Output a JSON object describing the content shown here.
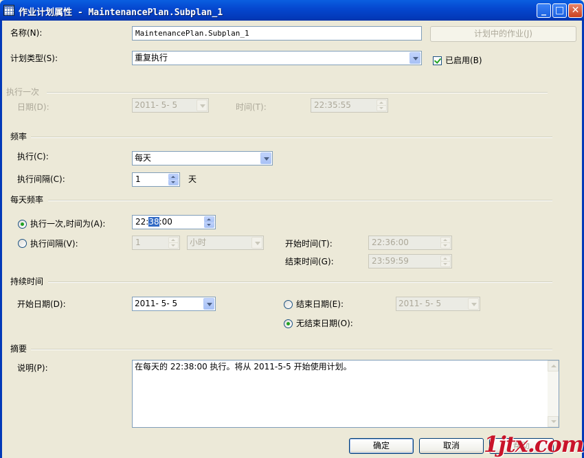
{
  "window": {
    "title": "作业计划属性 - MaintenancePlan.Subplan_1",
    "icon": "grid-icon",
    "buttons": {
      "minimize": "_",
      "maximize": "□",
      "close": "✕"
    }
  },
  "general": {
    "name_label": "名称(N):",
    "name_value": "MaintenancePlan.Subplan_1",
    "jobs_button": "计划中的作业(J)",
    "type_label": "计划类型(S):",
    "type_value": "重复执行",
    "enabled_label": "已启用(B)",
    "enabled_checked": true
  },
  "once": {
    "section_title": "执行一次",
    "date_label": "日期(D):",
    "date_value": "2011- 5- 5",
    "time_label": "时间(T):",
    "time_value": "22:35:55"
  },
  "frequency": {
    "section_title": "频率",
    "occurs_label": "执行(C):",
    "occurs_value": "每天",
    "recurs_label": "执行间隔(C):",
    "recurs_value": "1",
    "recurs_unit": "天"
  },
  "daily_frequency": {
    "section_title": "每天频率",
    "once_at_label": "执行一次,时间为(A):",
    "once_at_selected": true,
    "once_at_time_prefix": "22:",
    "once_at_time_highlight": "38",
    "once_at_time_suffix": ":00",
    "every_label": "执行间隔(V):",
    "every_value": "1",
    "every_unit": "小时",
    "start_time_label": "开始时间(T):",
    "start_time_value": "22:36:00",
    "end_time_label": "结束时间(G):",
    "end_time_value": "23:59:59"
  },
  "duration": {
    "section_title": "持续时间",
    "start_date_label": "开始日期(D):",
    "start_date_value": "2011- 5- 5",
    "end_date_label": "结束日期(E):",
    "end_date_value": "2011- 5- 5",
    "no_end_label": "无结束日期(O):",
    "no_end_selected": true
  },
  "summary": {
    "section_title": "摘要",
    "description_label": "说明(P):",
    "description_text": "在每天的 22:38:00 执行。将从 2011-5-5 开始使用计划。"
  },
  "footer": {
    "ok_label": "确定",
    "cancel_label": "取消",
    "help_label": "帮助"
  },
  "watermark": "1jtx.com",
  "colors": {
    "titlebar": "#0548D0",
    "dialog_bg": "#ECE9D8",
    "watermark": "#C9132A",
    "radio_dot": "#21A121"
  }
}
